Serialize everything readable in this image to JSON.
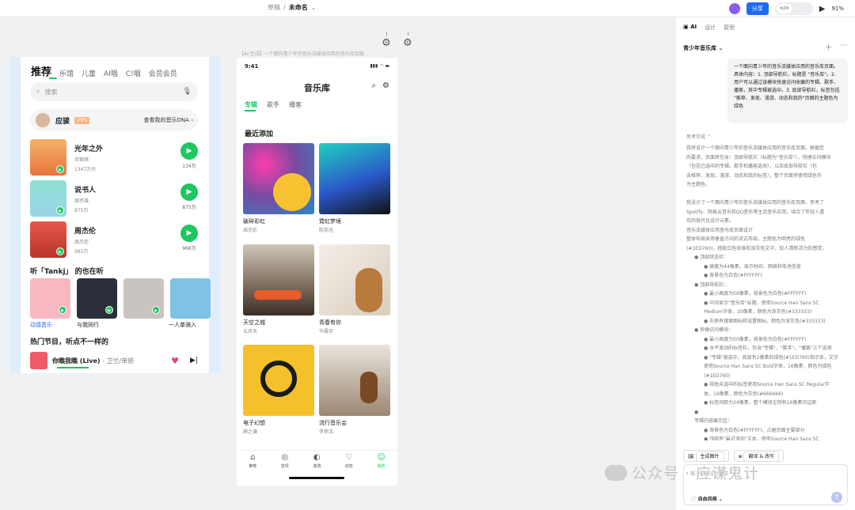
{
  "editor": {
    "breadcrumb": {
      "parent": "草稿",
      "sep": "/",
      "current": "未命名",
      "chev": "⌄"
    },
    "share_label": "分享",
    "code_toggle_label": "</>",
    "zoom": "91%"
  },
  "left_screen": {
    "tabs": [
      "推荐",
      "乐馆",
      "儿童",
      "AI唱",
      "C!唱",
      "会员会员"
    ],
    "search_placeholder": "搜索",
    "user": {
      "name": "应骏",
      "vip": "VIP5",
      "dna": "查看我的音乐DNA"
    },
    "songs": [
      {
        "title": "光年之外",
        "singer": "邓紫棋",
        "plays": "1347万台",
        "count": "134万"
      },
      {
        "title": "说书人",
        "singer": "周传雄",
        "plays": "875万",
        "count": "875万"
      },
      {
        "title": "周杰伦",
        "singer": "周杰伦",
        "plays": "985万",
        "count": "966万"
      }
    ],
    "section_listen": "听「Tankj」 的也在听",
    "listen_captions": [
      "动感音乐",
      "与我同行",
      "",
      "一人单骑入"
    ],
    "section_hot": "热门节目，听点不一样的",
    "player": {
      "song": "你瞧我瞧 (Live)",
      "artist": " - 卫兰/单依"
    }
  },
  "center_phone": {
    "frame_label": "【AI 生成】一个面向青少年的音乐流媒体应用的音乐库页面...",
    "status_time": "9:41",
    "status_icons": "▮▮▮ ◠ ▬",
    "title": "音乐库",
    "tabs": [
      "专辑",
      "歌手",
      "播客"
    ],
    "section": "最近添加",
    "albums": [
      {
        "title": "破碎彩虹",
        "artist": "周杰伦"
      },
      {
        "title": "霓虹梦境",
        "artist": "陈奕迅"
      },
      {
        "title": "天空之城",
        "artist": "五月天"
      },
      {
        "title": "青春有你",
        "artist": "华晨宇"
      },
      {
        "title": "电子幻想",
        "artist": "薛之谦"
      },
      {
        "title": "流行音乐会",
        "artist": "李荣浩"
      }
    ],
    "nav": [
      "推荐",
      "发现",
      "漫游",
      "动态",
      "我的"
    ]
  },
  "right_panel": {
    "tabs": [
      "AI",
      "设计",
      "原型"
    ],
    "project_name": "青少年音乐库",
    "chev": "⌄",
    "prompt": "一个面向青少年的音乐流媒体应用的音乐库页面。具体内容：1. 顶部导航栏，标题是 \"音乐库\"。2. 用户可以通过该模块快速访问收藏的专辑、歌手、播客，其中专辑被选中。3. 底部导航栏，标签包括 \"推荐、发现、漫游、动态和我的\"页面的主题色为绿色",
    "think_label": "思考完成 ⌃",
    "body_lines": [
      "我将设计一个面向青少年的音乐流媒体应用的音乐库页面。根据您",
      "的要求，页面将包含：顶部导航栏（标题为\"音乐库\"），快捷访问模块",
      "（包括已选中的专辑、歌手和播客选项），以及底部导航栏（包",
      "含推荐、发现、漫游、动态和我的标签）。整个页面将使用绿色作",
      "为主题色。",
      "",
      "我设计了一个面向青少年的音乐流媒体应用的音乐库页面，参考了",
      "Spotify、网易云音乐和QQ音乐等主流音乐应用，结合了年轻人喜",
      "欢的现代化设计元素。",
      "音乐流媒体应用音乐库页面设计",
      "整体布局采用垂直方向的流式布局，主题色为明亮的绿色",
      "(#1ED760)，搭配白色背景和深灰色文字，给人清新活力的感觉。"
    ],
    "bullets": [
      {
        "lvl": 1,
        "text": "● 顶部状态栏："
      },
      {
        "lvl": 2,
        "text": "● 高度为44像素，显示时间、网络和电池信息"
      },
      {
        "lvl": 2,
        "text": "● 背景色为白色(#FFFFFF)"
      },
      {
        "lvl": 1,
        "text": "● 顶部导航栏："
      },
      {
        "lvl": 2,
        "text": "● 最小高度为56像素，背景色为白色(#FFFFFF)"
      },
      {
        "lvl": 2,
        "text": "● 中间显示\"音乐库\"标题，使用Source Han Sans SC"
      },
      {
        "lvl": 2,
        "text": "   Medium字体，20像素，颜色为深灰色(#333333)"
      },
      {
        "lvl": 2,
        "text": "● 右侧有搜索图标和设置图标，颜色为深灰色(#333333)"
      },
      {
        "lvl": 1,
        "text": "● 快捷访问模块："
      },
      {
        "lvl": 2,
        "text": "● 最小高度为50像素，背景色为白色(#FFFFFF)"
      },
      {
        "lvl": 2,
        "text": "● 水平滚动的标签栏，包含\"专辑\"、\"歌手\"、\"播客\"三个选项"
      },
      {
        "lvl": 2,
        "text": "● \"专辑\"被选中，底部有2像素的绿色(#1ED760)指示条，文字"
      },
      {
        "lvl": 2,
        "text": "   使用Source Han Sans SC Bold字体，16像素，颜色为绿色"
      },
      {
        "lvl": 2,
        "text": "   (#1ED760)"
      },
      {
        "lvl": 2,
        "text": "● 其他未选中的标签使用Source Han Sans SC Regular字"
      },
      {
        "lvl": 2,
        "text": "   体，16像素，颜色为灰色(#666666)"
      },
      {
        "lvl": 2,
        "text": "● 标签间距为24像素，整个模块左侧有16像素内边距"
      },
      {
        "lvl": 1,
        "text": "●"
      },
      {
        "lvl": 1,
        "text": "   专辑内容展示区："
      },
      {
        "lvl": 2,
        "text": "● 背景色为白色(#FFFFFF)，占据页面主要部分"
      },
      {
        "lvl": 2,
        "text": "● 顶部有\"最近添加\"文本，使用Source Han Sans SC"
      }
    ],
    "footer_buttons": [
      "生成图片",
      "翻译 & 改写"
    ],
    "input_placeholder": "输入你的设计需求",
    "style_label": "自由风格"
  },
  "watermark": "公众号 · 应谋鬼计",
  "colors": {
    "accent": "#1ED760",
    "primary": "#1E6CF5"
  }
}
